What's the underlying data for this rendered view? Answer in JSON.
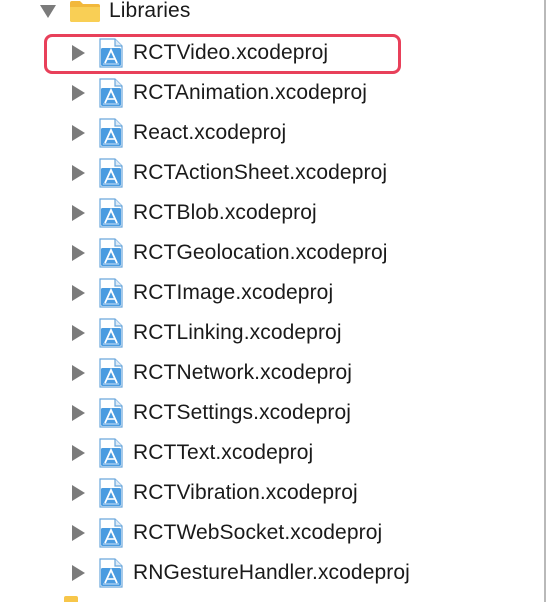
{
  "parent": {
    "label": "Libraries",
    "icon": "folder-icon",
    "expanded": true
  },
  "items": [
    {
      "label": "RCTVideo.xcodeproj",
      "icon": "xcode-project-icon",
      "highlighted": true
    },
    {
      "label": "RCTAnimation.xcodeproj",
      "icon": "xcode-project-icon"
    },
    {
      "label": "React.xcodeproj",
      "icon": "xcode-project-icon"
    },
    {
      "label": "RCTActionSheet.xcodeproj",
      "icon": "xcode-project-icon"
    },
    {
      "label": "RCTBlob.xcodeproj",
      "icon": "xcode-project-icon"
    },
    {
      "label": "RCTGeolocation.xcodeproj",
      "icon": "xcode-project-icon"
    },
    {
      "label": "RCTImage.xcodeproj",
      "icon": "xcode-project-icon"
    },
    {
      "label": "RCTLinking.xcodeproj",
      "icon": "xcode-project-icon"
    },
    {
      "label": "RCTNetwork.xcodeproj",
      "icon": "xcode-project-icon"
    },
    {
      "label": "RCTSettings.xcodeproj",
      "icon": "xcode-project-icon"
    },
    {
      "label": "RCTText.xcodeproj",
      "icon": "xcode-project-icon"
    },
    {
      "label": "RCTVibration.xcodeproj",
      "icon": "xcode-project-icon"
    },
    {
      "label": "RCTWebSocket.xcodeproj",
      "icon": "xcode-project-icon"
    },
    {
      "label": "RNGestureHandler.xcodeproj",
      "icon": "xcode-project-icon"
    }
  ],
  "colors": {
    "highlight": "#e8405a",
    "folder": "#f7c64a",
    "project_icon": "#4a9be0",
    "disclosure": "#7b7b7b"
  }
}
